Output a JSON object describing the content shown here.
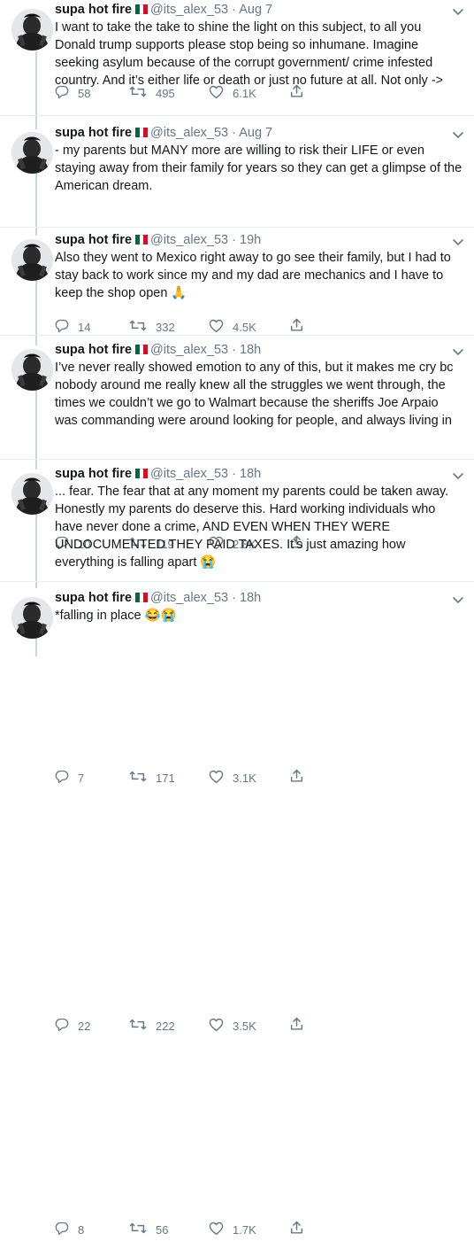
{
  "tweets": [
    {
      "name": "supa hot fire",
      "handle": "@its_alex_53",
      "time": "Aug 7",
      "text": "I want to take the take to shine the light on this subject, to all you Donald trump supports please stop being so inhumane. Imagine seeking asylum because of the corrupt government/ crime infested country. And it’s either life or death or just no future at all. Not only ->",
      "replies": "58",
      "retweets": "495",
      "likes": "6.1K"
    },
    {
      "name": "supa hot fire",
      "handle": "@its_alex_53",
      "time": "Aug 7",
      "text": "- my parents but MANY more are willing to risk their LIFE or even staying away from their family for years so they can get a glimpse of the American dream.",
      "replies": "14",
      "retweets": "332",
      "likes": "4.5K"
    },
    {
      "name": "supa hot fire",
      "handle": "@its_alex_53",
      "time": "19h",
      "text": "Also they went to Mexico right away to go see their family, but I had to stay back to work since my and my dad are mechanics and I have to keep the shop open 🙏",
      "replies": "10",
      "retweets": "119",
      "likes": "2.8K"
    },
    {
      "name": "supa hot fire",
      "handle": "@its_alex_53",
      "time": "18h",
      "text": "I’ve never really showed emotion to any of this, but it makes me cry bc nobody around me really knew all the struggles we went through, the times we couldn’t we go to Walmart because the sheriffs Joe Arpaio was commanding were around looking for people, and always living in",
      "replies": "7",
      "retweets": "171",
      "likes": "3.1K"
    },
    {
      "name": "supa hot fire",
      "handle": "@its_alex_53",
      "time": "18h",
      "text": "... fear. The fear that at any moment my parents could be taken away. Honestly my parents do deserve this. Hard working individuals who have never done a crime, AND EVEN WHEN THEY WERE UNDOCUMENTED THEY PAID TAXES. It’s just amazing how everything is falling apart 😭",
      "replies": "22",
      "retweets": "222",
      "likes": "3.5K"
    },
    {
      "name": "supa hot fire",
      "handle": "@its_alex_53",
      "time": "18h",
      "text": "*falling in place 😂😭",
      "replies": "8",
      "retweets": "56",
      "likes": "1.7K"
    }
  ],
  "separator": "·",
  "colors": {
    "text": "#14171a",
    "secondary": "#657786",
    "thread_line": "#ccd6dd",
    "divider": "#e6ecf0"
  },
  "icons": {
    "reply": "reply-icon",
    "retweet": "retweet-icon",
    "like": "heart-icon",
    "share": "share-icon",
    "caret": "chevron-down-icon",
    "flag": "mexico-flag-icon"
  }
}
